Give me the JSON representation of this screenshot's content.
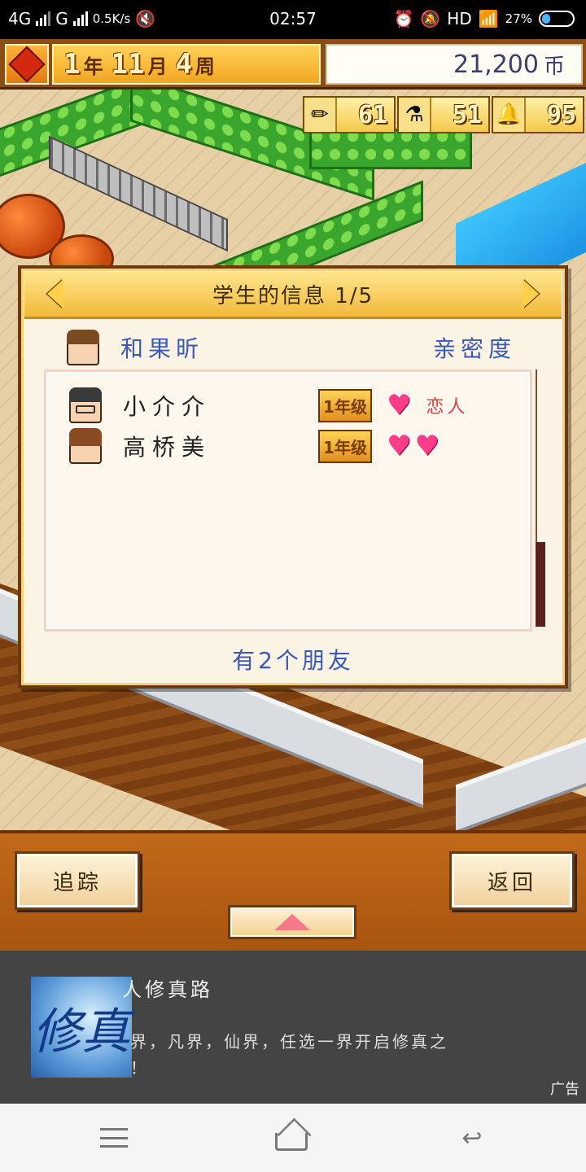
{
  "status_bar": {
    "network": "4G",
    "network2": "G",
    "speed": "0.5K/s",
    "time": "02:57",
    "hd": "HD",
    "battery": "27%"
  },
  "game_header": {
    "year": "1",
    "year_unit": "年",
    "month": "11",
    "month_unit": "月",
    "week": "4",
    "week_unit": "周",
    "money": "21,200",
    "money_unit": "币"
  },
  "stats": [
    {
      "icon": "pencil-icon",
      "value": "61"
    },
    {
      "icon": "flask-icon",
      "value": "51"
    },
    {
      "icon": "bell-icon",
      "value": "95"
    }
  ],
  "dialog": {
    "title": "学生的信息 1/5",
    "owner_name": "和果昕",
    "affinity_header": "亲密度",
    "friends": [
      {
        "name": "小介介",
        "grade": "1年级",
        "hearts": 1,
        "relation": "恋人"
      },
      {
        "name": "高桥美",
        "grade": "1年级",
        "hearts": 2,
        "relation": ""
      }
    ],
    "friend_count": "有2个朋友"
  },
  "buttons": {
    "track": "追踪",
    "back": "返回"
  },
  "ad": {
    "title": "人修真路",
    "desc": "界，凡界，仙界，任选一界开启修真之\n！",
    "tag": "广告",
    "image_text": "修真"
  },
  "colors": {
    "accent_blue": "#3a58b8",
    "heart": "#ff3d8a",
    "relation_red": "#e04040"
  }
}
